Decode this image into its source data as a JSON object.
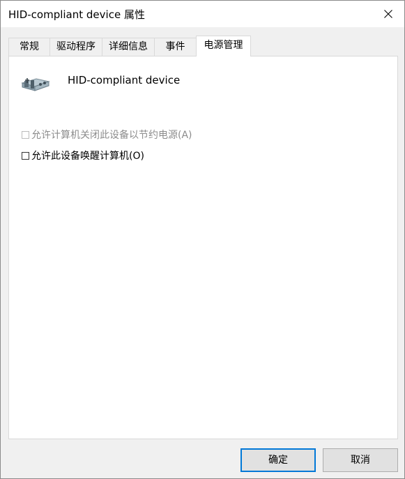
{
  "window": {
    "title": "HID-compliant device 属性"
  },
  "tabs": [
    {
      "label": "常规"
    },
    {
      "label": "驱动程序"
    },
    {
      "label": "详细信息"
    },
    {
      "label": "事件"
    },
    {
      "label": "电源管理"
    }
  ],
  "active_tab": "电源管理",
  "device": {
    "icon": "hid-device-icon",
    "name": "HID-compliant device"
  },
  "power_options": [
    {
      "label": "允许计算机关闭此设备以节约电源(A)",
      "checked": false,
      "enabled": false
    },
    {
      "label": "允许此设备唤醒计算机(O)",
      "checked": false,
      "enabled": true
    }
  ],
  "buttons": {
    "ok_label": "确定",
    "cancel_label": "取消"
  },
  "colors": {
    "accent": "#0078d7",
    "disabled_text": "#8c8c8c"
  }
}
